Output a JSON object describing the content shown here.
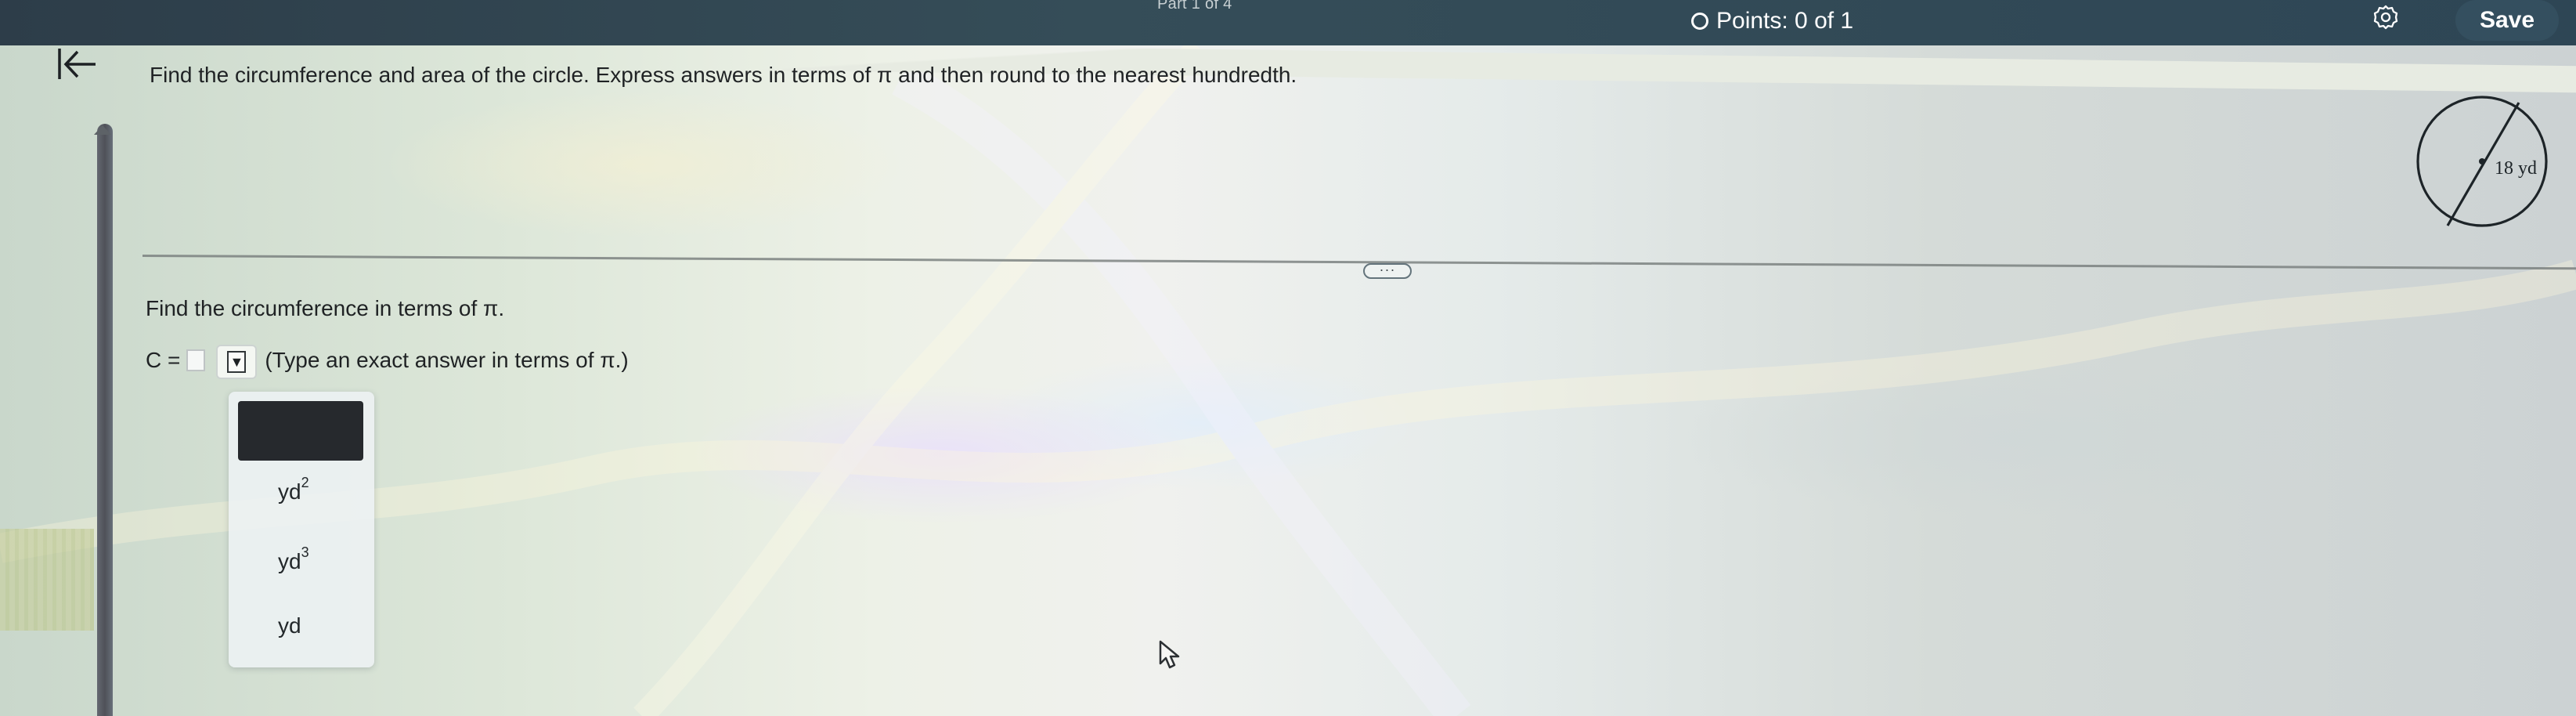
{
  "header": {
    "part": "Part 1 of 4",
    "points_label": "Points: 0 of 1",
    "save_label": "Save"
  },
  "question": {
    "prompt": "Find the circumference and area of the circle. Express answers in terms of π and then round to the nearest hundredth."
  },
  "figure": {
    "diameter_label": "18 yd"
  },
  "part1": {
    "instruction": "Find the circumference in terms of π.",
    "answer_prefix": "C =",
    "answer_value": "",
    "answer_hint": "(Type an exact answer in terms of π.)"
  },
  "unit_dropdown": {
    "selected": "",
    "options": [
      {
        "base": "yd",
        "exponent": "2"
      },
      {
        "base": "yd",
        "exponent": "3"
      },
      {
        "base": "yd",
        "exponent": ""
      }
    ]
  }
}
